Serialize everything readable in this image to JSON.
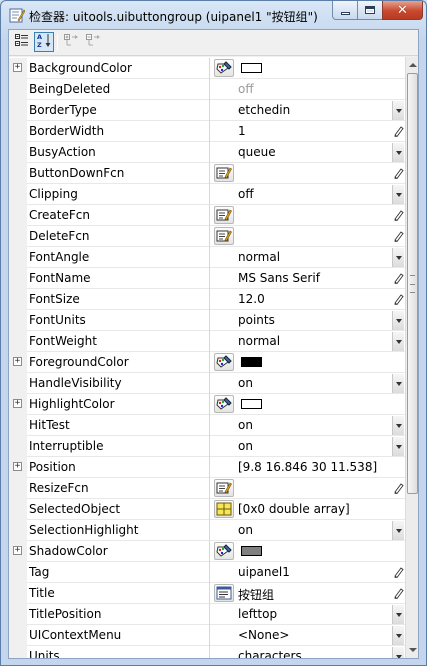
{
  "window": {
    "title": "检查器: uitools.uibuttongroup (uipanel1 \"按钮组\")",
    "close_glyph": "✕"
  },
  "toolbar": {
    "buttons": [
      {
        "name": "categorized-view-icon",
        "pressed": false
      },
      {
        "name": "alphabetical-sort-icon",
        "pressed": true
      },
      {
        "name": "expand-all-icon",
        "pressed": false
      },
      {
        "name": "collapse-all-icon",
        "pressed": false
      }
    ]
  },
  "scrollbar": {
    "position_fraction": 0.0,
    "visible_fraction": 0.74
  },
  "properties": [
    {
      "name": "BackgroundColor",
      "expandable": true,
      "editor": "color-palette-icon",
      "value": "",
      "swatch": "#ffffff",
      "control": "none"
    },
    {
      "name": "BeingDeleted",
      "expandable": false,
      "editor": null,
      "value": "off",
      "disabled": true,
      "control": "none"
    },
    {
      "name": "BorderType",
      "expandable": false,
      "editor": null,
      "value": "etchedin",
      "control": "dropdown"
    },
    {
      "name": "BorderWidth",
      "expandable": false,
      "editor": null,
      "value": "1",
      "control": "pencil"
    },
    {
      "name": "BusyAction",
      "expandable": false,
      "editor": null,
      "value": "queue",
      "control": "dropdown"
    },
    {
      "name": "ButtonDownFcn",
      "expandable": false,
      "editor": "callback-editor-icon",
      "value": "",
      "control": "pencil"
    },
    {
      "name": "Clipping",
      "expandable": false,
      "editor": null,
      "value": "off",
      "control": "dropdown"
    },
    {
      "name": "CreateFcn",
      "expandable": false,
      "editor": "callback-editor-icon",
      "value": "",
      "control": "pencil"
    },
    {
      "name": "DeleteFcn",
      "expandable": false,
      "editor": "callback-editor-icon",
      "value": "",
      "control": "pencil"
    },
    {
      "name": "FontAngle",
      "expandable": false,
      "editor": null,
      "value": "normal",
      "control": "dropdown"
    },
    {
      "name": "FontName",
      "expandable": false,
      "editor": null,
      "value": "MS Sans Serif",
      "control": "pencil"
    },
    {
      "name": "FontSize",
      "expandable": false,
      "editor": null,
      "value": "12.0",
      "control": "pencil"
    },
    {
      "name": "FontUnits",
      "expandable": false,
      "editor": null,
      "value": "points",
      "control": "dropdown"
    },
    {
      "name": "FontWeight",
      "expandable": false,
      "editor": null,
      "value": "normal",
      "control": "dropdown"
    },
    {
      "name": "ForegroundColor",
      "expandable": true,
      "editor": "color-palette-icon",
      "value": "",
      "swatch": "#000000",
      "control": "none"
    },
    {
      "name": "HandleVisibility",
      "expandable": false,
      "editor": null,
      "value": "on",
      "control": "dropdown"
    },
    {
      "name": "HighlightColor",
      "expandable": true,
      "editor": "color-palette-icon",
      "value": "",
      "swatch": "#ffffff",
      "control": "none"
    },
    {
      "name": "HitTest",
      "expandable": false,
      "editor": null,
      "value": "on",
      "control": "dropdown"
    },
    {
      "name": "Interruptible",
      "expandable": false,
      "editor": null,
      "value": "on",
      "control": "dropdown"
    },
    {
      "name": "Position",
      "expandable": true,
      "editor": null,
      "value": "[9.8 16.846 30 11.538]",
      "control": "none"
    },
    {
      "name": "ResizeFcn",
      "expandable": false,
      "editor": "callback-editor-icon",
      "value": "",
      "control": "pencil"
    },
    {
      "name": "SelectedObject",
      "expandable": false,
      "editor": "array-editor-icon",
      "value": "[0x0  double array]",
      "control": "none"
    },
    {
      "name": "SelectionHighlight",
      "expandable": false,
      "editor": null,
      "value": "on",
      "control": "dropdown"
    },
    {
      "name": "ShadowColor",
      "expandable": true,
      "editor": "color-palette-icon",
      "value": "",
      "swatch": "#808080",
      "control": "none"
    },
    {
      "name": "Tag",
      "expandable": false,
      "editor": null,
      "value": "uipanel1",
      "control": "pencil"
    },
    {
      "name": "Title",
      "expandable": false,
      "editor": "text-editor-icon",
      "value": "按钮组",
      "control": "pencil"
    },
    {
      "name": "TitlePosition",
      "expandable": false,
      "editor": null,
      "value": "lefttop",
      "control": "dropdown"
    },
    {
      "name": "UIContextMenu",
      "expandable": false,
      "editor": null,
      "value": "<None>",
      "control": "dropdown"
    },
    {
      "name": "Units",
      "expandable": false,
      "editor": null,
      "value": "characters",
      "control": "dropdown"
    }
  ]
}
